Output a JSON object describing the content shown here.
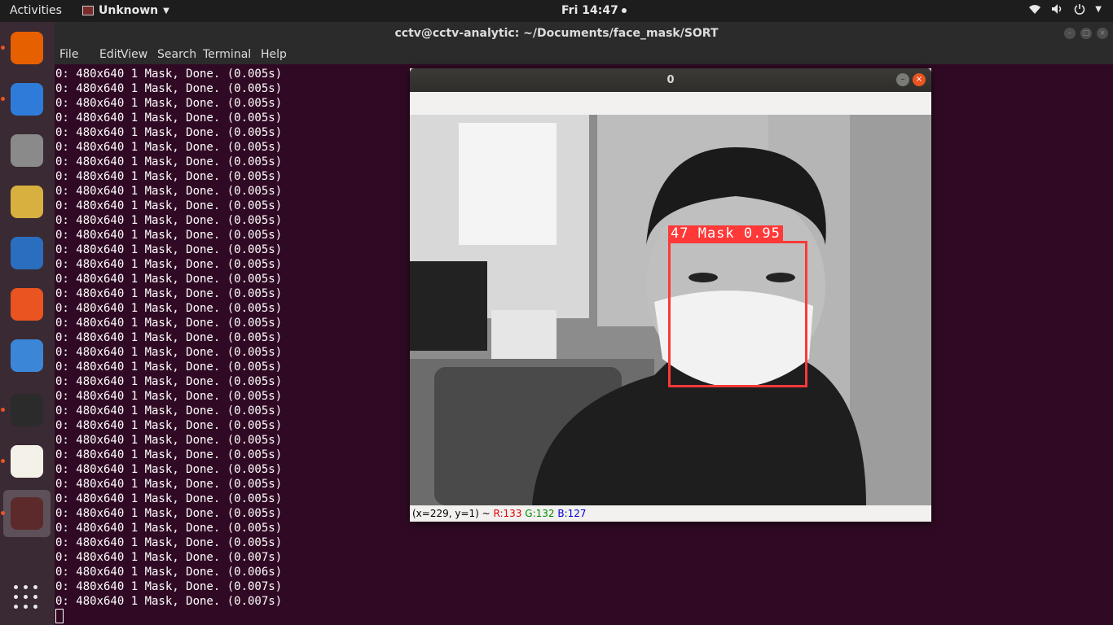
{
  "topbar": {
    "activities": "Activities",
    "app_name": "Unknown",
    "clock": "Fri 14:47"
  },
  "terminal": {
    "title": "cctv@cctv-analytic: ~/Documents/face_mask/SORT",
    "menu": [
      "File",
      "Edit",
      "View",
      "Search",
      "Terminal",
      "Help"
    ],
    "lines": [
      "0: 480x640 1 Mask, Done. (0.005s)",
      "0: 480x640 1 Mask, Done. (0.005s)",
      "0: 480x640 1 Mask, Done. (0.005s)",
      "0: 480x640 1 Mask, Done. (0.005s)",
      "0: 480x640 1 Mask, Done. (0.005s)",
      "0: 480x640 1 Mask, Done. (0.005s)",
      "0: 480x640 1 Mask, Done. (0.005s)",
      "0: 480x640 1 Mask, Done. (0.005s)",
      "0: 480x640 1 Mask, Done. (0.005s)",
      "0: 480x640 1 Mask, Done. (0.005s)",
      "0: 480x640 1 Mask, Done. (0.005s)",
      "0: 480x640 1 Mask, Done. (0.005s)",
      "0: 480x640 1 Mask, Done. (0.005s)",
      "0: 480x640 1 Mask, Done. (0.005s)",
      "0: 480x640 1 Mask, Done. (0.005s)",
      "0: 480x640 1 Mask, Done. (0.005s)",
      "0: 480x640 1 Mask, Done. (0.005s)",
      "0: 480x640 1 Mask, Done. (0.005s)",
      "0: 480x640 1 Mask, Done. (0.005s)",
      "0: 480x640 1 Mask, Done. (0.005s)",
      "0: 480x640 1 Mask, Done. (0.005s)",
      "0: 480x640 1 Mask, Done. (0.005s)",
      "0: 480x640 1 Mask, Done. (0.005s)",
      "0: 480x640 1 Mask, Done. (0.005s)",
      "0: 480x640 1 Mask, Done. (0.005s)",
      "0: 480x640 1 Mask, Done. (0.005s)",
      "0: 480x640 1 Mask, Done. (0.005s)",
      "0: 480x640 1 Mask, Done. (0.005s)",
      "0: 480x640 1 Mask, Done. (0.005s)",
      "0: 480x640 1 Mask, Done. (0.005s)",
      "0: 480x640 1 Mask, Done. (0.005s)",
      "0: 480x640 1 Mask, Done. (0.005s)",
      "0: 480x640 1 Mask, Done. (0.005s)",
      "0: 480x640 1 Mask, Done. (0.007s)",
      "0: 480x640 1 Mask, Done. (0.006s)",
      "0: 480x640 1 Mask, Done. (0.007s)",
      "0: 480x640 1 Mask, Done. (0.007s)"
    ]
  },
  "dock": {
    "items": [
      {
        "name": "firefox",
        "icon": "firefox-icon",
        "color": "#e66000",
        "running": true,
        "active": false
      },
      {
        "name": "thunderbird",
        "icon": "thunderbird-icon",
        "color": "#2f7bd9",
        "running": true,
        "active": false
      },
      {
        "name": "files",
        "icon": "files-icon",
        "color": "#8a8a8a",
        "running": false,
        "active": false
      },
      {
        "name": "rhythmbox",
        "icon": "speaker-icon",
        "color": "#d8b040",
        "running": false,
        "active": false
      },
      {
        "name": "libreoffice-writer",
        "icon": "writer-icon",
        "color": "#2a6fbf",
        "running": false,
        "active": false
      },
      {
        "name": "software",
        "icon": "software-store-icon",
        "color": "#e95420",
        "running": false,
        "active": false
      },
      {
        "name": "help",
        "icon": "help-icon",
        "color": "#3b86d6",
        "running": false,
        "active": false
      },
      {
        "name": "terminal",
        "icon": "terminal-icon",
        "color": "#2b2b2b",
        "running": true,
        "active": false
      },
      {
        "name": "text-editor",
        "icon": "text-editor-icon",
        "color": "#f4f1e8",
        "running": true,
        "active": false
      },
      {
        "name": "unknown-app",
        "icon": "unknown-app-icon",
        "color": "#5c2a2a",
        "running": true,
        "active": true
      }
    ],
    "show_apps_icon": "app-grid-icon"
  },
  "viewer": {
    "title": "0",
    "detection_label": "47 Mask 0.95",
    "status_coords": "(x=229, y=1) ~ ",
    "status_r": "R:133",
    "status_g": "G:132",
    "status_b": "B:127"
  },
  "colors": {
    "terminal_bg": "#300a24",
    "detection_box": "#ff3838",
    "ubuntu_orange": "#e95420"
  }
}
